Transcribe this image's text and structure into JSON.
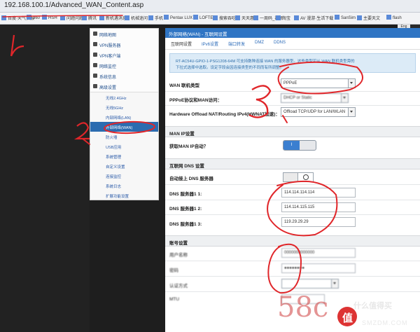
{
  "browser": {
    "url": "192.168.100.1/Advanced_WAN_Content.asp",
    "bookmarks": [
      "百度·天气预报",
      "360",
      "HSH",
      "问题问题",
      "腾讯",
      "新机遇消息",
      "机械迷问",
      "手机",
      "Pentax LUX",
      "LOFTER",
      "搜索吞吃",
      "天天惠",
      "一周码_视频",
      "淘宝",
      "AV 漫游·生活下载",
      "SanSim",
      "主要天文",
      "flash"
    ],
    "lang_badge": "Eng"
  },
  "sidebar": {
    "items": [
      {
        "label": "网络地图",
        "icon": "home-icon",
        "type": "main"
      },
      {
        "label": "VPN服务器",
        "icon": "vpn-icon",
        "type": "main"
      },
      {
        "label": "VPN客户端",
        "icon": "globe-icon",
        "type": "main"
      },
      {
        "label": "网络监控",
        "icon": "monitor-icon",
        "type": "main"
      },
      {
        "label": "系统信息",
        "icon": "info-icon",
        "type": "main"
      },
      {
        "label": "高级设置",
        "icon": "wrench-icon",
        "type": "main"
      },
      {
        "label": "无线2.4GHz",
        "type": "sub"
      },
      {
        "label": "无线5GHz",
        "type": "sub"
      },
      {
        "label": "内部网络(LAN)",
        "type": "sub"
      },
      {
        "label": "外部网络(WAN)",
        "type": "sub",
        "active": true
      },
      {
        "label": "防火墙",
        "type": "sub"
      },
      {
        "label": "USB应用",
        "type": "sub"
      },
      {
        "label": "系统管理",
        "type": "sub"
      },
      {
        "label": "自定义设置",
        "type": "sub"
      },
      {
        "label": "连接监控",
        "type": "sub"
      },
      {
        "label": "系统日志",
        "type": "sub"
      },
      {
        "label": "扩展功能设置",
        "type": "sub"
      }
    ]
  },
  "main": {
    "title": "外部网络(WAN) - 互联网设置",
    "tabs": [
      "互联网设置",
      "IPv6设置",
      "端口转发",
      "DMZ",
      "DDNS"
    ],
    "info_lines": [
      "RT-AC54U-GPIO-1-PSG1208-64M 可支持数种连接 WAN 的服务器型。这些类型可从 WAN 联机类型旁的",
      "下拉式选择中选取。设定字段会因连接类型的不同而有所调整。"
    ],
    "wan_type_label": "WAN 联机类型",
    "wan_type_value": "PPPoE",
    "pppoe_label": "PPPoE协议和MAN访问：",
    "pppoe_value": "DHCP or Static",
    "hwnat_label": "Hardware Offload NAT/Routing IPv4(HWNAT加速)：",
    "hwnat_value": "Offload TCP/UDP for LAN/WLAN",
    "section_man_ip": "MAN IP设置",
    "man_ip_auto_label": "获取MAN IP自动？",
    "toggle_on": "I",
    "section_dns": "互联网 DNS 设置",
    "dns_auto_label": "自动接上 DNS 服务器",
    "dns1_label": "DNS 服务器1 1:",
    "dns1_value": "114.114.114.114",
    "dns2_label": "DNS 服务器1 2:",
    "dns2_value": "114.114.115.115",
    "dns3_label": "DNS 服务器1 3:",
    "dns3_value": "119.29.29.29",
    "section_account": "账号设置",
    "user_label": "用户名称",
    "pass_label": "密码",
    "auth_label": "认证方式",
    "mtu_label": "MTU",
    "user_value": "0000000000000",
    "pass_value": "●●●●●●●●"
  },
  "annotations": [
    "1",
    "2",
    "3"
  ],
  "watermark": {
    "text": "58c",
    "site_cn": "什么值得买",
    "site_en": "SMZDM.COM",
    "logo_char": "值"
  }
}
